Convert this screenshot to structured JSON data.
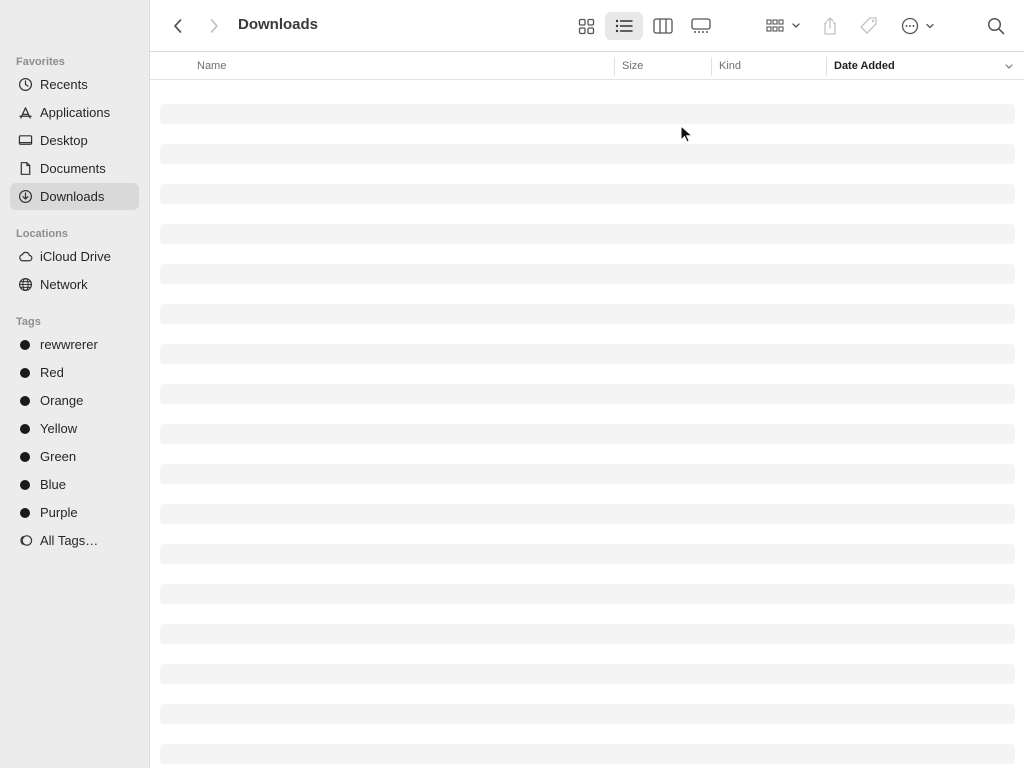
{
  "window": {
    "title": "Downloads"
  },
  "sidebar": {
    "favorites_title": "Favorites",
    "favorites": [
      {
        "label": "Recents",
        "icon": "clock-icon"
      },
      {
        "label": "Applications",
        "icon": "applications-icon"
      },
      {
        "label": "Desktop",
        "icon": "desktop-icon"
      },
      {
        "label": "Documents",
        "icon": "document-icon"
      },
      {
        "label": "Downloads",
        "icon": "download-icon",
        "selected": true
      }
    ],
    "locations_title": "Locations",
    "locations": [
      {
        "label": "iCloud Drive",
        "icon": "cloud-icon"
      },
      {
        "label": "Network",
        "icon": "globe-icon"
      }
    ],
    "tags_title": "Tags",
    "tags": [
      {
        "label": "rewwrerer",
        "color": "#1a1a1a"
      },
      {
        "label": "Red",
        "color": "#1a1a1a"
      },
      {
        "label": "Orange",
        "color": "#1a1a1a"
      },
      {
        "label": "Yellow",
        "color": "#1a1a1a"
      },
      {
        "label": "Green",
        "color": "#1a1a1a"
      },
      {
        "label": "Blue",
        "color": "#1a1a1a"
      },
      {
        "label": "Purple",
        "color": "#1a1a1a"
      }
    ],
    "all_tags": {
      "label": "All Tags…",
      "icon": "all-tags-icon"
    }
  },
  "toolbar": {
    "back_icon": "chevron-left-icon",
    "forward_icon": "chevron-right-icon",
    "views": [
      "icon-view-icon",
      "list-view-icon",
      "column-view-icon",
      "gallery-view-icon"
    ],
    "selected_view": "list-view-icon",
    "group_icon": "group-by-icon",
    "share_icon": "share-icon",
    "tag_icon": "tag-icon",
    "action_icon": "more-actions-icon",
    "search_icon": "search-icon"
  },
  "columns": {
    "name": "Name",
    "size": "Size",
    "kind": "Kind",
    "date_added": "Date Added",
    "sorted_by": "Date Added"
  },
  "file_rows": {
    "state": "loading",
    "placeholder_row_count": 17
  }
}
